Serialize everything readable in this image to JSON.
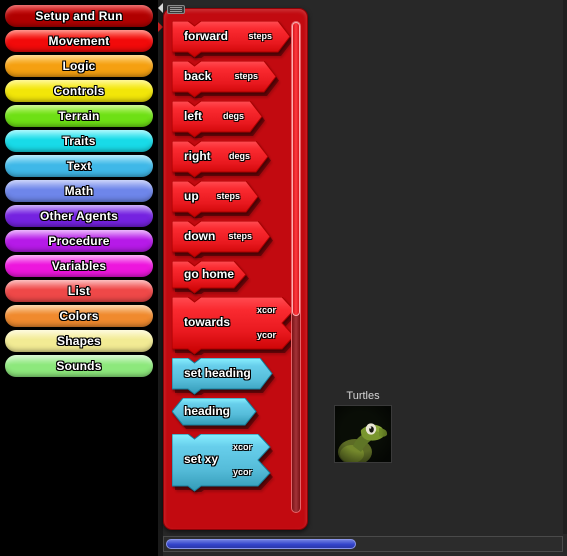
{
  "app": {
    "canvas_bg": "#282828",
    "palette_bg": "#c20a10",
    "sidebar_bg": "#000000"
  },
  "sidebar": {
    "name": "category-palette",
    "items": [
      {
        "label": "Setup and Run",
        "color": "#b00000",
        "hi": "#e02020"
      },
      {
        "label": "Movement",
        "color": "#f20a0a",
        "hi": "#ff5b4c"
      },
      {
        "label": "Logic",
        "color": "#f5a011",
        "hi": "#ffc85a"
      },
      {
        "label": "Controls",
        "color": "#f2e609",
        "hi": "#fff45e"
      },
      {
        "label": "Terrain",
        "color": "#6ee015",
        "hi": "#b2f45c"
      },
      {
        "label": "Traits",
        "color": "#18dbe8",
        "hi": "#7df3fa"
      },
      {
        "label": "Text",
        "color": "#3fb8e8",
        "hi": "#92e0f7"
      },
      {
        "label": "Math",
        "color": "#6e86ea",
        "hi": "#aebbf6"
      },
      {
        "label": "Other Agents",
        "color": "#7522e0",
        "hi": "#b285f5"
      },
      {
        "label": "Procedure",
        "color": "#b61ae8",
        "hi": "#df8dfa"
      },
      {
        "label": "Variables",
        "color": "#ed16dd",
        "hi": "#fa85f2"
      },
      {
        "label": "List",
        "color": "#ef4848",
        "hi": "#fa9b9b"
      },
      {
        "label": "Colors",
        "color": "#f08a2e",
        "hi": "#fac186"
      },
      {
        "label": "Shapes",
        "color": "#f2eb94",
        "hi": "#fdf8cb"
      },
      {
        "label": "Sounds",
        "color": "#8de87c",
        "hi": "#c6f5bd"
      }
    ]
  },
  "palette": {
    "name": "movement-block-palette",
    "grip_tooltip": "drag palette",
    "scroll_thumb_pct": 60,
    "blocks": [
      {
        "label": "forward",
        "shape": "command",
        "color": "#e8181e",
        "params": [
          "steps"
        ]
      },
      {
        "label": "back",
        "shape": "command",
        "color": "#e8181e",
        "params": [
          "steps"
        ]
      },
      {
        "label": "left",
        "shape": "command",
        "color": "#e8181e",
        "params": [
          "degs"
        ]
      },
      {
        "label": "right",
        "shape": "command",
        "color": "#e8181e",
        "params": [
          "degs"
        ]
      },
      {
        "label": "up",
        "shape": "command",
        "color": "#e8181e",
        "params": [
          "steps"
        ]
      },
      {
        "label": "down",
        "shape": "command",
        "color": "#e8181e",
        "params": [
          "steps"
        ]
      },
      {
        "label": "go home",
        "shape": "command",
        "color": "#e8181e",
        "params": []
      },
      {
        "label": "towards",
        "shape": "command2",
        "color": "#e8181e",
        "params": [
          "xcor",
          "ycor"
        ]
      },
      {
        "label": "set heading",
        "shape": "command",
        "color": "#55bcd9",
        "params": []
      },
      {
        "label": "heading",
        "shape": "reporter",
        "color": "#55bcd9",
        "params": []
      },
      {
        "label": "set xy",
        "shape": "command2",
        "color": "#55bcd9",
        "params": [
          "xcor",
          "ycor"
        ]
      }
    ]
  },
  "agents": {
    "turtles": {
      "label": "Turtles",
      "thumb_name": "turtle-avatar"
    }
  },
  "scrollbars": {
    "horizontal": {
      "name": "canvas-hscroll",
      "thumb_color": "#3344cc",
      "thumb_pct": 47
    },
    "vertical": {
      "name": "palette-vscroll",
      "thumb_color": "#ff3b40"
    }
  }
}
